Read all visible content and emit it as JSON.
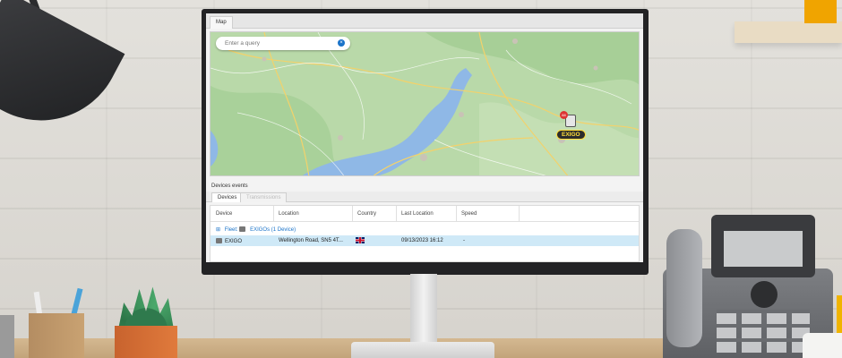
{
  "map_panel": {
    "tab_label": "Map",
    "search_placeholder": "Enter a query",
    "search_clear_glyph": "×",
    "marker_label": "EXIGO",
    "marker_badge": "88"
  },
  "devices_panel": {
    "section_title": "Devices events",
    "tabs": [
      {
        "label": "Devices",
        "active": true
      },
      {
        "label": "Transmissions",
        "active": false
      }
    ],
    "columns": [
      "Device",
      "Location",
      "Country",
      "Last Location",
      "Speed"
    ],
    "group": {
      "expand_glyph": "⊞",
      "prefix": "Fleet:",
      "label": "EXIGOs (1 Device)"
    },
    "rows": [
      {
        "device": "EXIGO",
        "location": "Wellington Road, SN5 4T...",
        "country_flag": "uk-flag-icon",
        "last_location": "09/13/2023 16:12",
        "speed": "-"
      }
    ]
  },
  "colors": {
    "accent": "#1a73c9",
    "selected_row": "#cfe9f7",
    "marker_label_text": "#ffdc3a",
    "map_land": "#b5d6a5",
    "map_water": "#8fb8e6"
  }
}
